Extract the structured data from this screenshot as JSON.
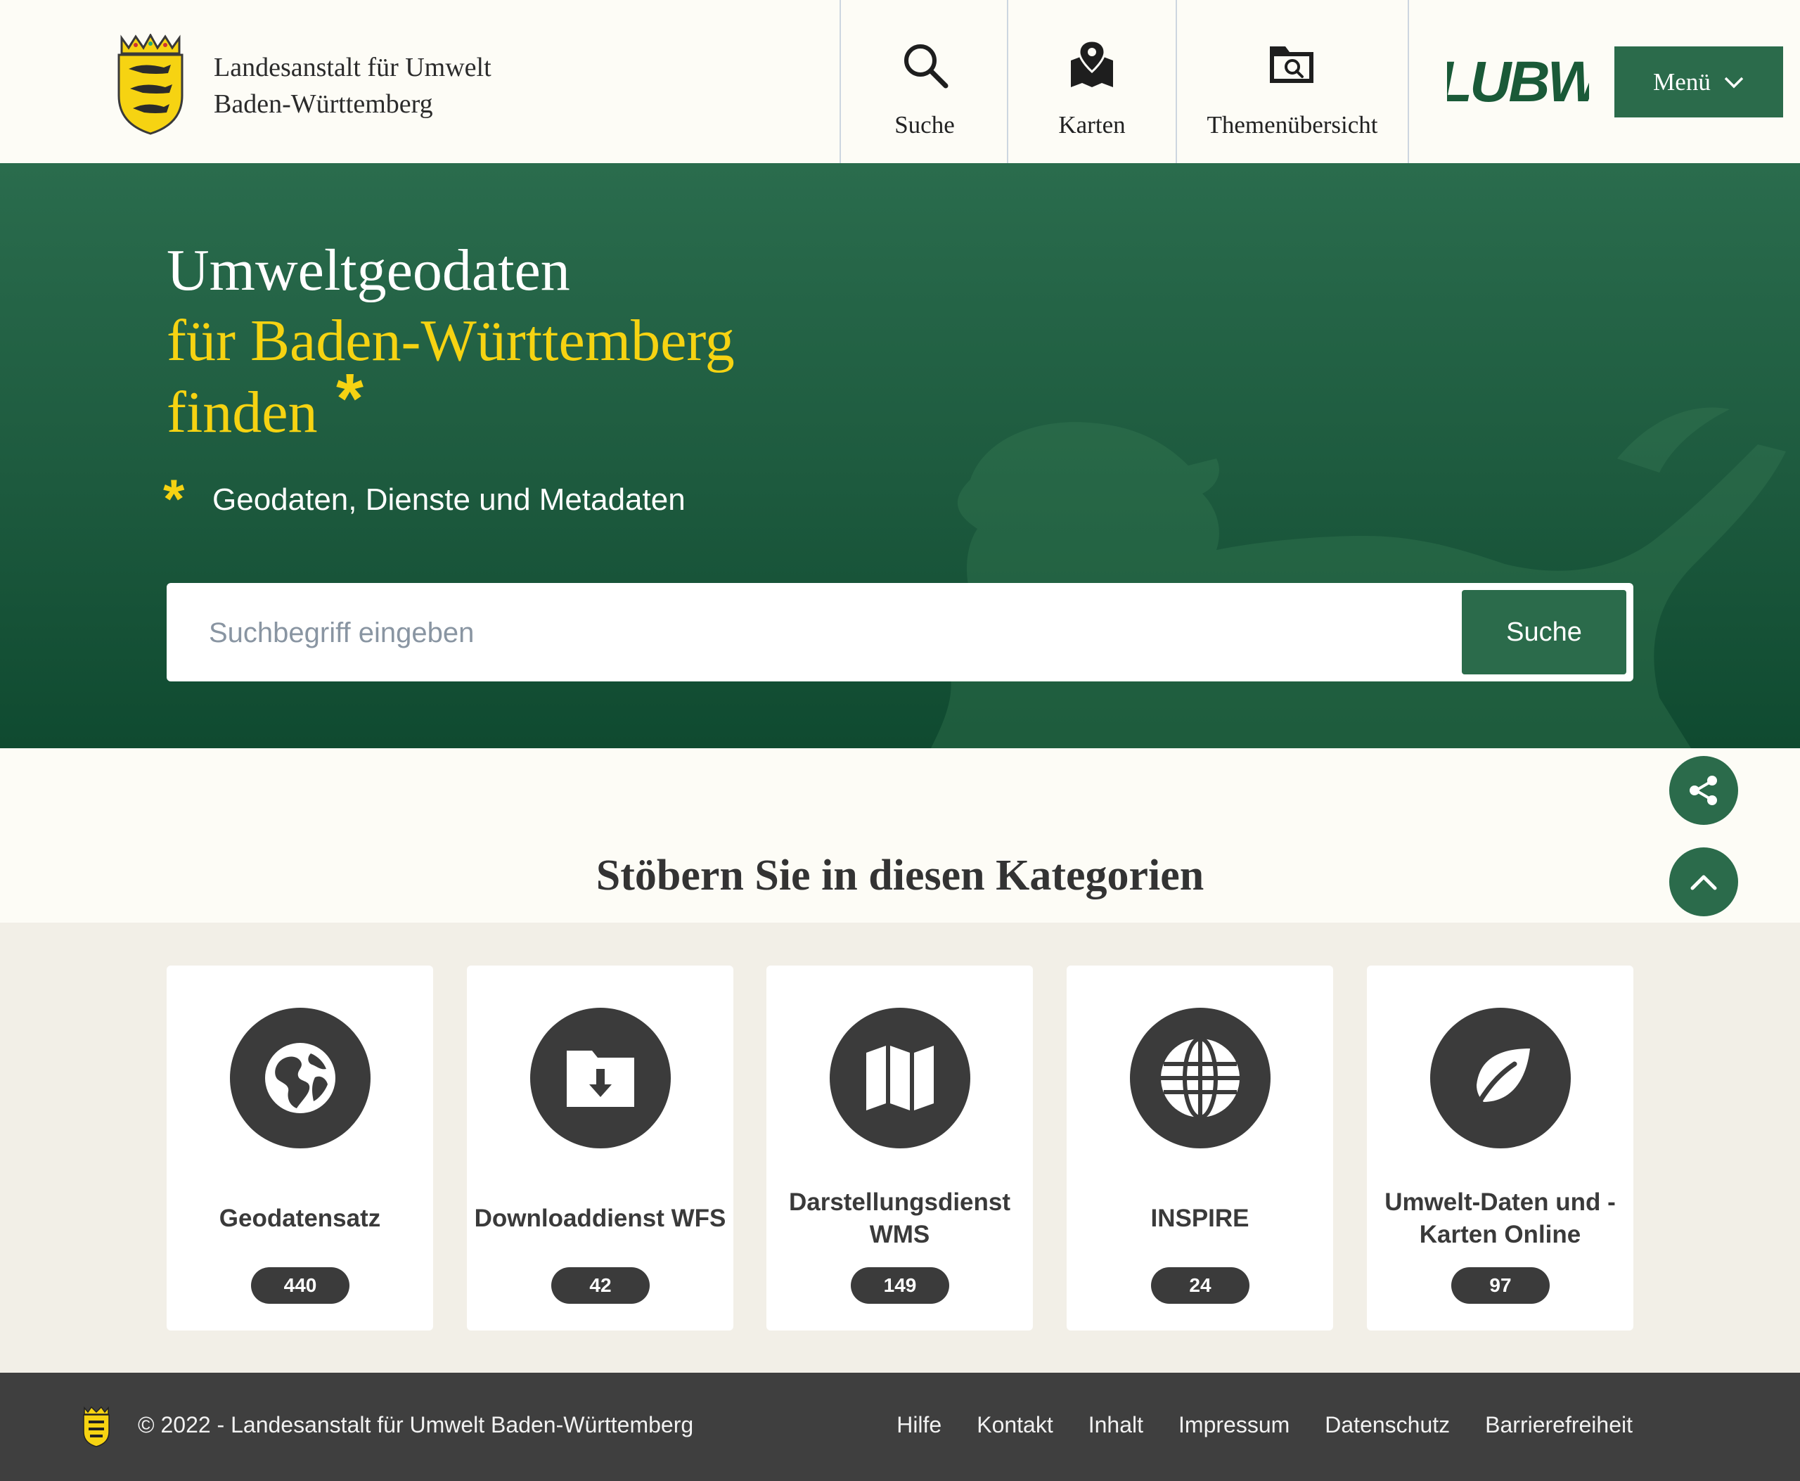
{
  "header": {
    "org_line1": "Landesanstalt für Umwelt",
    "org_line2": "Baden-Württemberg",
    "nav": [
      {
        "label": "Suche",
        "icon": "search-icon"
      },
      {
        "label": "Karten",
        "icon": "map-pin-icon"
      },
      {
        "label": "Themenübersicht",
        "icon": "folder-search-icon"
      }
    ],
    "logo_text": "LUBW",
    "menu_label": "Menü"
  },
  "hero": {
    "line1": "Umweltgeodaten",
    "line2": "für Baden-Württemberg",
    "line3": "finden",
    "star": "*",
    "subtitle": "Geodaten, Dienste und Metadaten",
    "search_placeholder": "Suchbegriff eingeben",
    "search_button": "Suche"
  },
  "categories": {
    "heading": "Stöbern Sie in diesen Kategorien",
    "items": [
      {
        "title": "Geodatensatz",
        "count": "440",
        "icon": "globe-icon"
      },
      {
        "title": "Downloaddienst WFS",
        "count": "42",
        "icon": "folder-download-icon"
      },
      {
        "title": "Darstellungsdienst WMS",
        "count": "149",
        "icon": "map-icon"
      },
      {
        "title": "INSPIRE",
        "count": "24",
        "icon": "globe-grid-icon"
      },
      {
        "title": "Umwelt-Daten und -Karten Online",
        "count": "97",
        "icon": "leaf-icon"
      }
    ]
  },
  "footer": {
    "copyright": "© 2022 - Landesanstalt für Umwelt Baden-Württemberg",
    "links": [
      "Hilfe",
      "Kontakt",
      "Inhalt",
      "Impressum",
      "Datenschutz",
      "Barrierefreiheit"
    ]
  },
  "colors": {
    "brand_green": "#2b6b4b",
    "accent_yellow": "#f6d312",
    "footer_bg": "#3f3f3f",
    "card_section_bg": "#f2efe7"
  }
}
